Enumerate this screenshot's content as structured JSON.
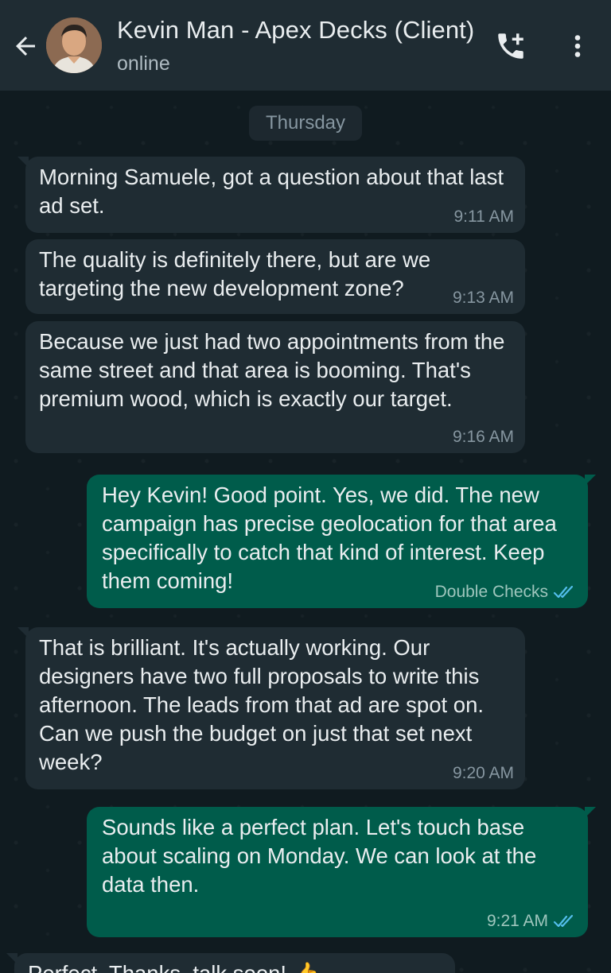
{
  "header": {
    "contact_name": "Kevin Man - Apex Decks (Client)",
    "status": "online",
    "back_icon": "arrow-left-icon",
    "call_icon": "add-call-icon",
    "menu_icon": "more-vertical-icon"
  },
  "chat": {
    "date_label": "Thursday",
    "messages": [
      {
        "direction": "in",
        "text": "Morning Samuele, got a question about that last ad set.",
        "time": "9:11 AM"
      },
      {
        "direction": "in",
        "text": "The quality is definitely there, but are we targeting the new development zone?",
        "time": "9:13 AM"
      },
      {
        "direction": "in",
        "text": "Because we just had two appointments from the same street and that area is booming. That's premium wood, which is exactly our target.",
        "time": "9:16 AM"
      },
      {
        "direction": "out",
        "text": "Hey Kevin! Good point. Yes, we did. The new campaign has precise geolocation for that area specifically to catch that kind of interest. Keep them coming!",
        "time": "Double Checks",
        "status_icon": "double-check-icon"
      },
      {
        "direction": "in",
        "text": "That is brilliant. It's actually working. Our designers have two full proposals to write this afternoon. The leads from that ad are spot on. Can we push the budget on just that set next week?",
        "time": "9:20 AM"
      },
      {
        "direction": "out",
        "text": "Sounds like a perfect plan. Let's touch base about scaling on Monday. We can look at the data then.",
        "time": "9:21 AM",
        "status_icon": "double-check-icon"
      },
      {
        "direction": "in",
        "text": "Perfect. Thanks, talk soon! 👍",
        "time": ""
      }
    ]
  },
  "colors": {
    "header_bg": "#1f2c33",
    "incoming_bubble": "#1f2c33",
    "outgoing_bubble": "#005c4b",
    "read_tick": "#53bdeb"
  }
}
